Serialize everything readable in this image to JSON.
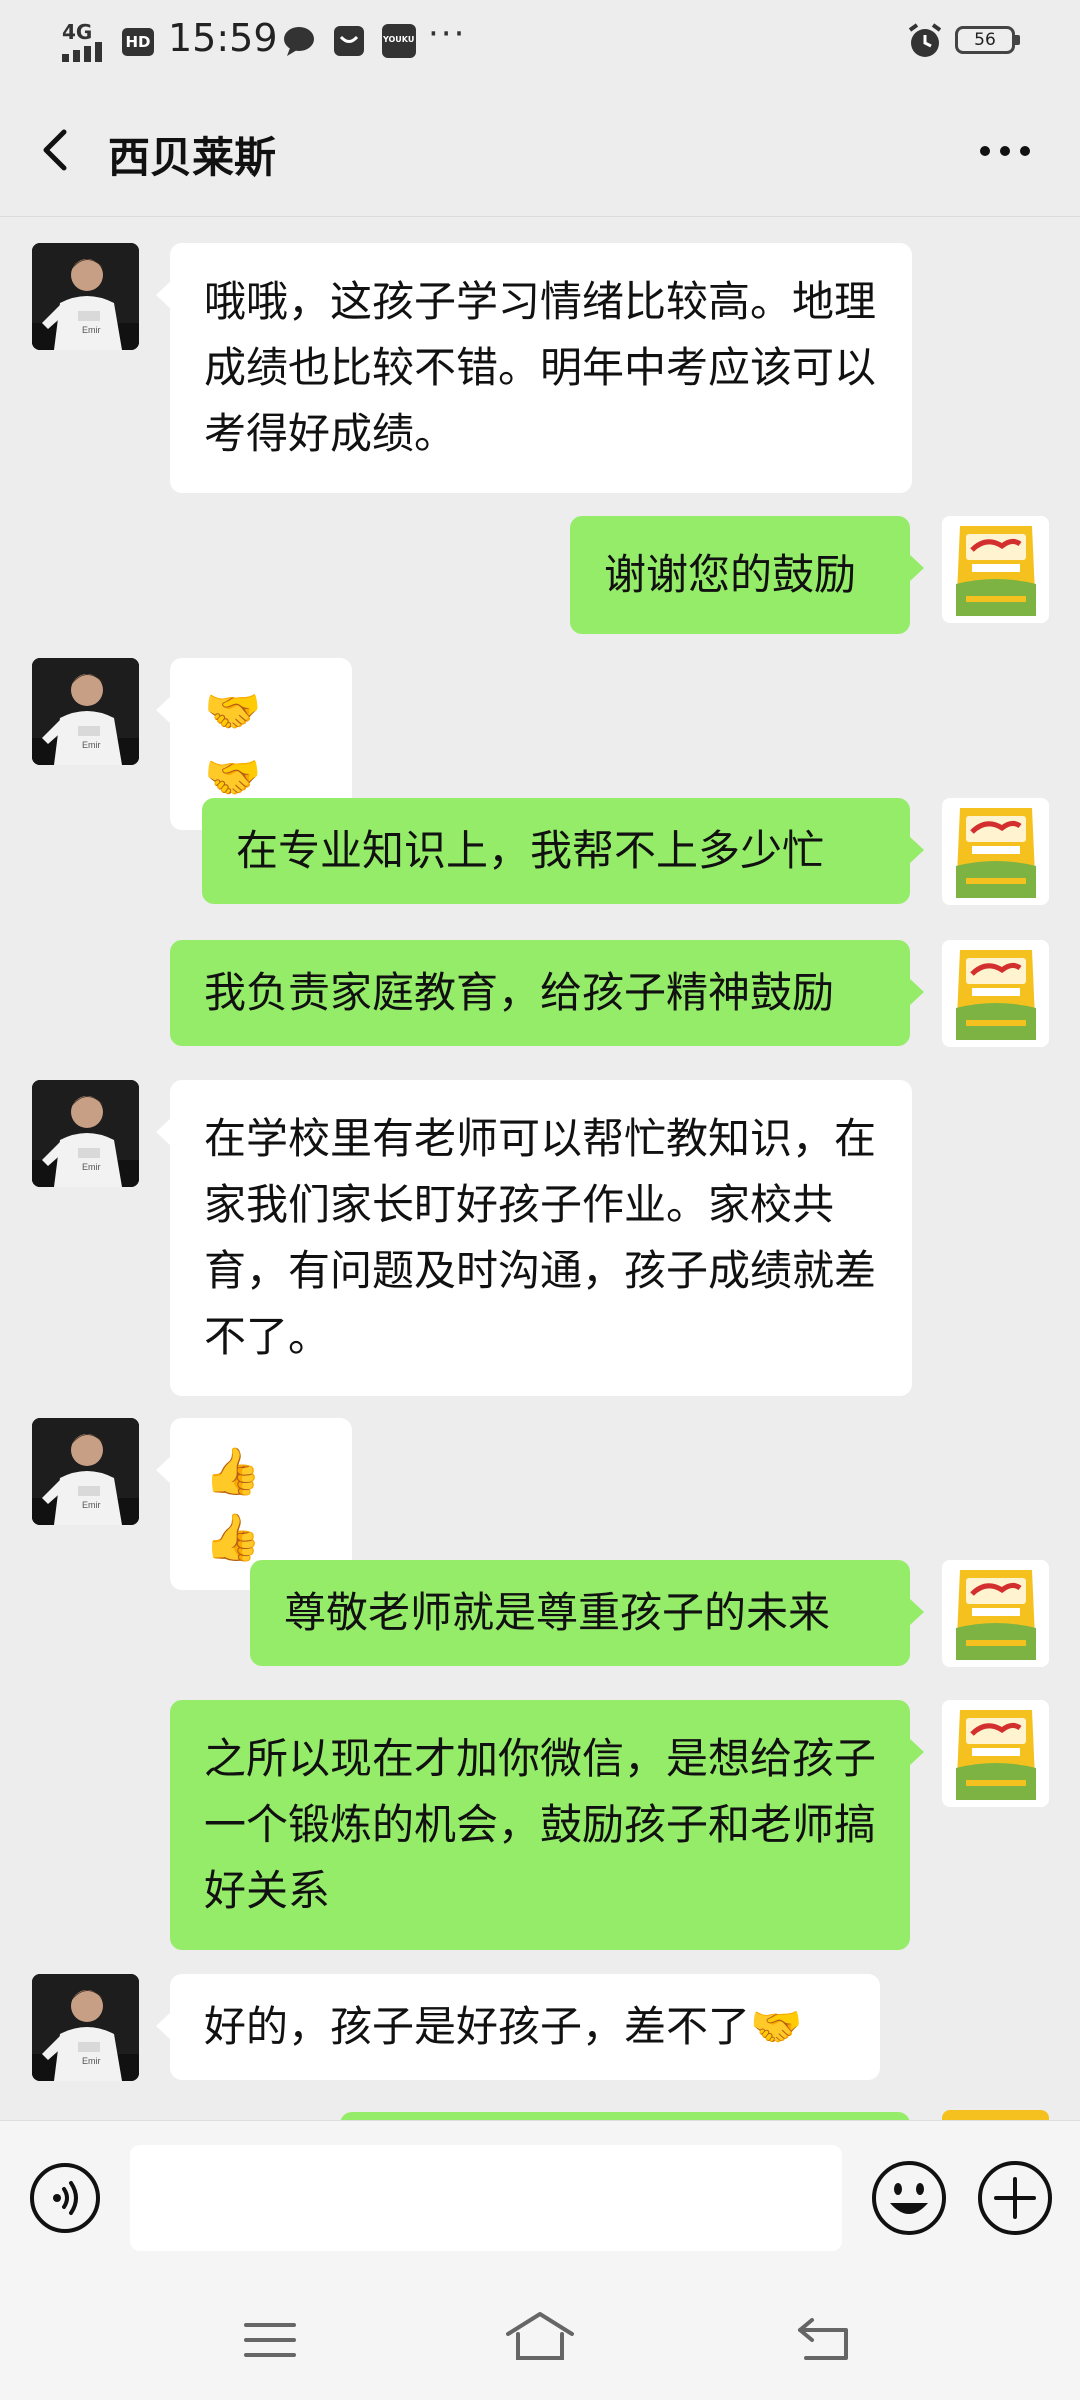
{
  "status_bar": {
    "network": "4G",
    "hd": "HD",
    "time": "15:59",
    "app_icons": [
      "chat-bubble-icon",
      "message-icon",
      "youku-icon"
    ],
    "youku_label": "YOUKU",
    "overflow": "···",
    "battery": "56"
  },
  "header": {
    "title": "西贝莱斯"
  },
  "messages": [
    {
      "side": "left",
      "avatar": "player-avatar",
      "text": "哦哦，这孩子学习情绪比较高。地理成绩也比较不错。明年中考应该可以考得好成绩。"
    },
    {
      "side": "right",
      "avatar": "rice-bag-avatar",
      "text": "谢谢您的鼓励"
    },
    {
      "side": "left",
      "avatar": "player-avatar",
      "text": "🤝🤝"
    },
    {
      "side": "right",
      "avatar": "rice-bag-avatar",
      "text": "在专业知识上，我帮不上多少忙"
    },
    {
      "side": "right",
      "avatar": "rice-bag-avatar",
      "text": "我负责家庭教育，给孩子精神鼓励"
    },
    {
      "side": "left",
      "avatar": "player-avatar",
      "text": "在学校里有老师可以帮忙教知识，在家我们家长盯好孩子作业。家校共育，有问题及时沟通，孩子成绩就差不了。"
    },
    {
      "side": "left",
      "avatar": "player-avatar",
      "text": "👍👍"
    },
    {
      "side": "right",
      "avatar": "rice-bag-avatar",
      "text": "尊敬老师就是尊重孩子的未来"
    },
    {
      "side": "right",
      "avatar": "rice-bag-avatar",
      "text": "之所以现在才加你微信，是想给孩子一个锻炼的机会，鼓励孩子和老师搞好关系"
    },
    {
      "side": "left",
      "avatar": "player-avatar",
      "text": "好的，孩子是好孩子，差不了🤝"
    }
  ],
  "input_bar": {
    "value": "",
    "icons": [
      "voice-icon",
      "emoji-icon",
      "plus-icon"
    ]
  },
  "nav_bar": {
    "icons": [
      "menu-icon",
      "home-icon",
      "back-icon"
    ]
  },
  "colors": {
    "background": "#ededed",
    "outgoing_bubble": "#95ec69",
    "incoming_bubble": "#ffffff"
  }
}
